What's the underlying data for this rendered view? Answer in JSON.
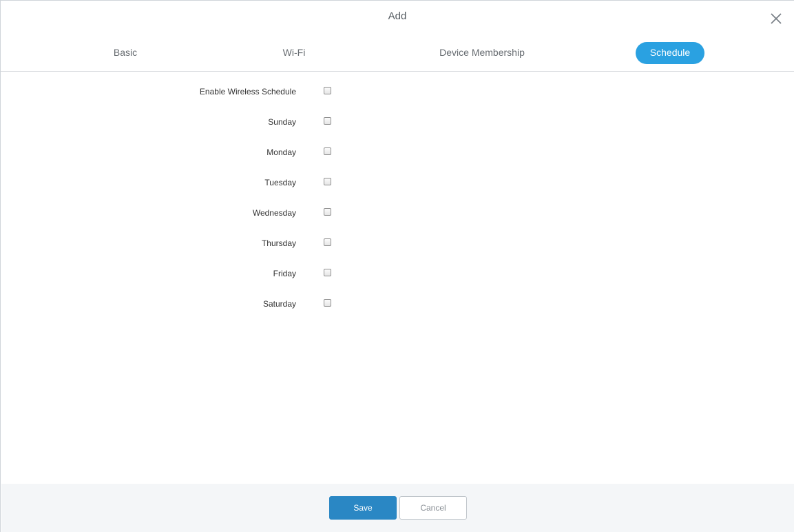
{
  "dialog": {
    "title": "Add",
    "close_icon": "close-icon"
  },
  "tabs": [
    {
      "label": "Basic",
      "active": false
    },
    {
      "label": "Wi-Fi",
      "active": false
    },
    {
      "label": "Device Membership",
      "active": false
    },
    {
      "label": "Schedule",
      "active": true
    }
  ],
  "schedule": {
    "rows": [
      {
        "label": "Enable Wireless Schedule",
        "checked": false
      },
      {
        "label": "Sunday",
        "checked": false
      },
      {
        "label": "Monday",
        "checked": false
      },
      {
        "label": "Tuesday",
        "checked": false
      },
      {
        "label": "Wednesday",
        "checked": false
      },
      {
        "label": "Thursday",
        "checked": false
      },
      {
        "label": "Friday",
        "checked": false
      },
      {
        "label": "Saturday",
        "checked": false
      }
    ]
  },
  "footer": {
    "save_label": "Save",
    "cancel_label": "Cancel"
  },
  "colors": {
    "accent": "#2aa1e1",
    "save_button": "#2a87c4",
    "footer_bg": "#f4f6f8"
  }
}
